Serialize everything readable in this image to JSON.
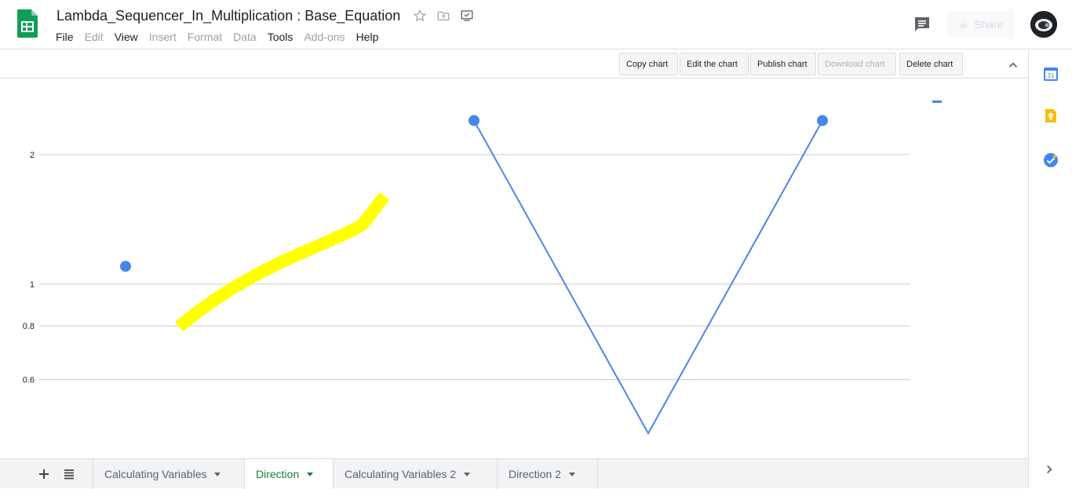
{
  "header": {
    "doc_title": "Lambda_Sequencer_In_Multiplication : Base_Equation",
    "share_label": "Share",
    "menu": [
      {
        "label": "File",
        "enabled": true
      },
      {
        "label": "Edit",
        "enabled": false
      },
      {
        "label": "View",
        "enabled": true
      },
      {
        "label": "Insert",
        "enabled": false
      },
      {
        "label": "Format",
        "enabled": false
      },
      {
        "label": "Data",
        "enabled": false
      },
      {
        "label": "Tools",
        "enabled": true
      },
      {
        "label": "Add-ons",
        "enabled": false
      },
      {
        "label": "Help",
        "enabled": true
      }
    ]
  },
  "chart_toolbar": {
    "copy": "Copy chart",
    "edit": "Edit the chart",
    "publish": "Publish chart",
    "download": "Download chart",
    "delete": "Delete chart"
  },
  "chart_data": {
    "type": "line",
    "scale": "log",
    "y_ticks": [
      "2",
      "1",
      "0.8",
      "0.6"
    ],
    "y_tick_values": [
      2,
      1,
      0.8,
      0.6
    ],
    "series_color": "#4a86e8",
    "highlight_color": "#ffff00",
    "points": [
      {
        "x": 0,
        "y": 1.1
      },
      {
        "x": 2,
        "y": 2.4
      },
      {
        "x": 3,
        "y": 0.45
      },
      {
        "x": 4,
        "y": 2.4
      }
    ]
  },
  "sheets": {
    "tabs": [
      {
        "label": "Calculating Variables",
        "active": false
      },
      {
        "label": "Direction",
        "active": true
      },
      {
        "label": "Calculating Variables 2",
        "active": false
      },
      {
        "label": "Direction 2",
        "active": false
      }
    ]
  },
  "colors": {
    "sheets_green": "#188038",
    "accent_blue": "#4a86e8",
    "border": "#dadce0"
  }
}
